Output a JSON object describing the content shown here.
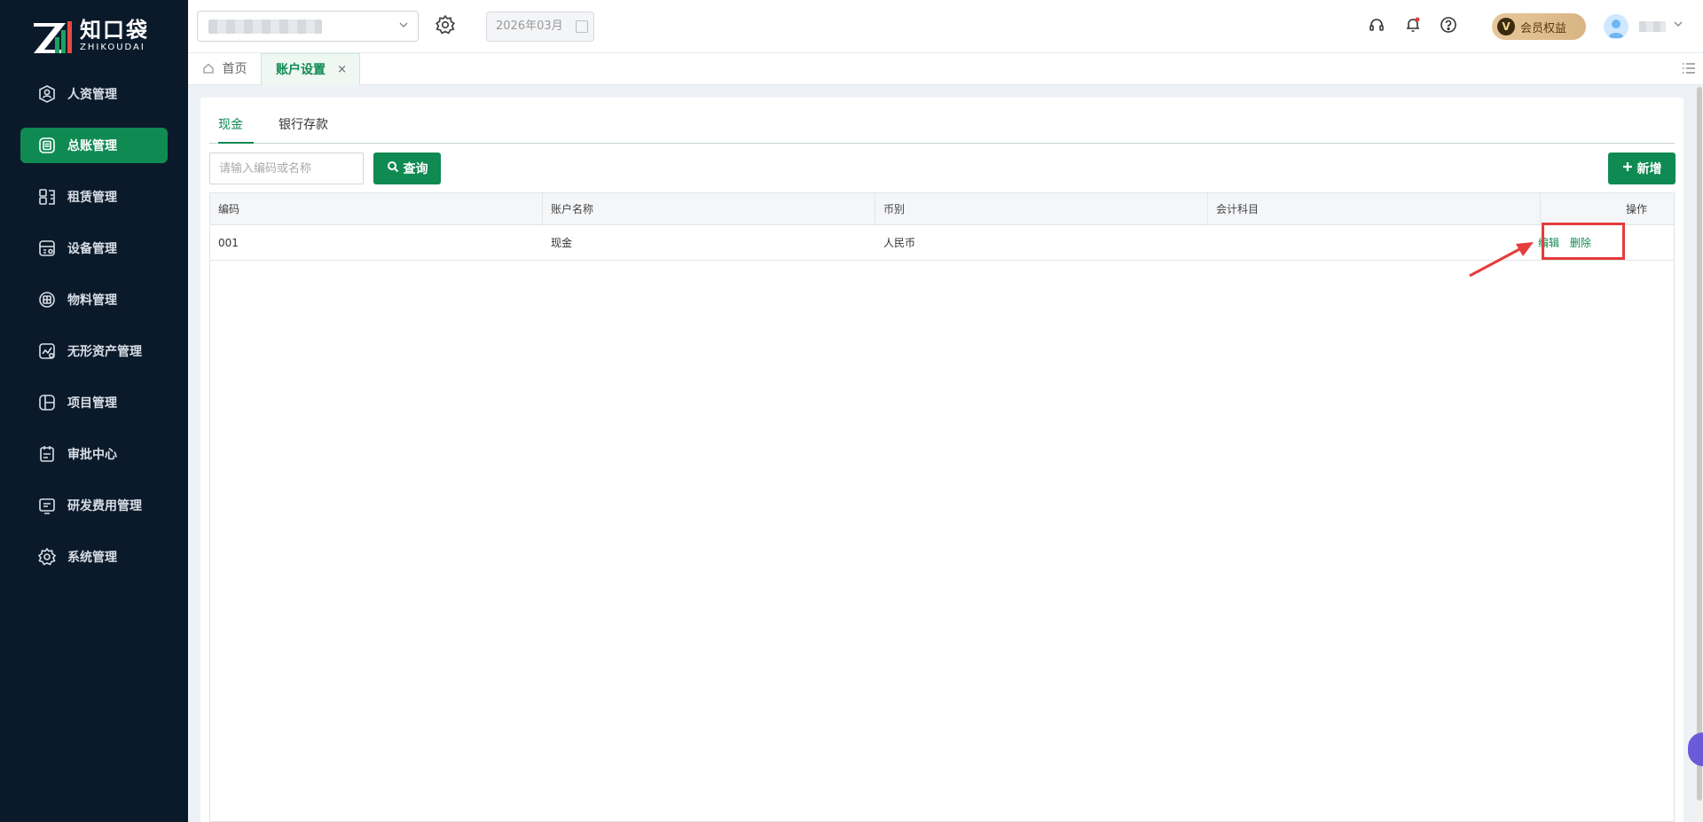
{
  "brand": {
    "name_cn": "知口袋",
    "name_en": "ZHIKOUDAI",
    "accent": "#0f8a52"
  },
  "sidebar": {
    "items": [
      {
        "label": "人资管理",
        "icon": "person-badge-icon",
        "active": false
      },
      {
        "label": "总账管理",
        "icon": "ledger-icon",
        "active": true
      },
      {
        "label": "租赁管理",
        "icon": "lease-icon",
        "active": false
      },
      {
        "label": "设备管理",
        "icon": "device-icon",
        "active": false
      },
      {
        "label": "物料管理",
        "icon": "material-icon",
        "active": false
      },
      {
        "label": "无形资产管理",
        "icon": "intangible-asset-icon",
        "active": false
      },
      {
        "label": "项目管理",
        "icon": "project-icon",
        "active": false
      },
      {
        "label": "审批中心",
        "icon": "approval-icon",
        "active": false
      },
      {
        "label": "研发费用管理",
        "icon": "rd-expense-icon",
        "active": false
      },
      {
        "label": "系统管理",
        "icon": "gear-icon",
        "active": false
      }
    ]
  },
  "header": {
    "period": "2026年03月",
    "vip_label": "会员权益",
    "vip_badge": "V"
  },
  "tabs": {
    "home": "首页",
    "current": "账户设置",
    "close": "×"
  },
  "page": {
    "subtabs": [
      "现金",
      "银行存款"
    ],
    "search_placeholder": "请输入编码或名称",
    "query_button": "查询",
    "add_button": "新增",
    "table": {
      "columns": [
        "编码",
        "账户名称",
        "币别",
        "会计科目",
        "操作"
      ],
      "rows": [
        {
          "code": "001",
          "name": "现金",
          "currency": "人民币",
          "subject": "",
          "edit": "编辑",
          "delete": "删除"
        }
      ]
    }
  }
}
